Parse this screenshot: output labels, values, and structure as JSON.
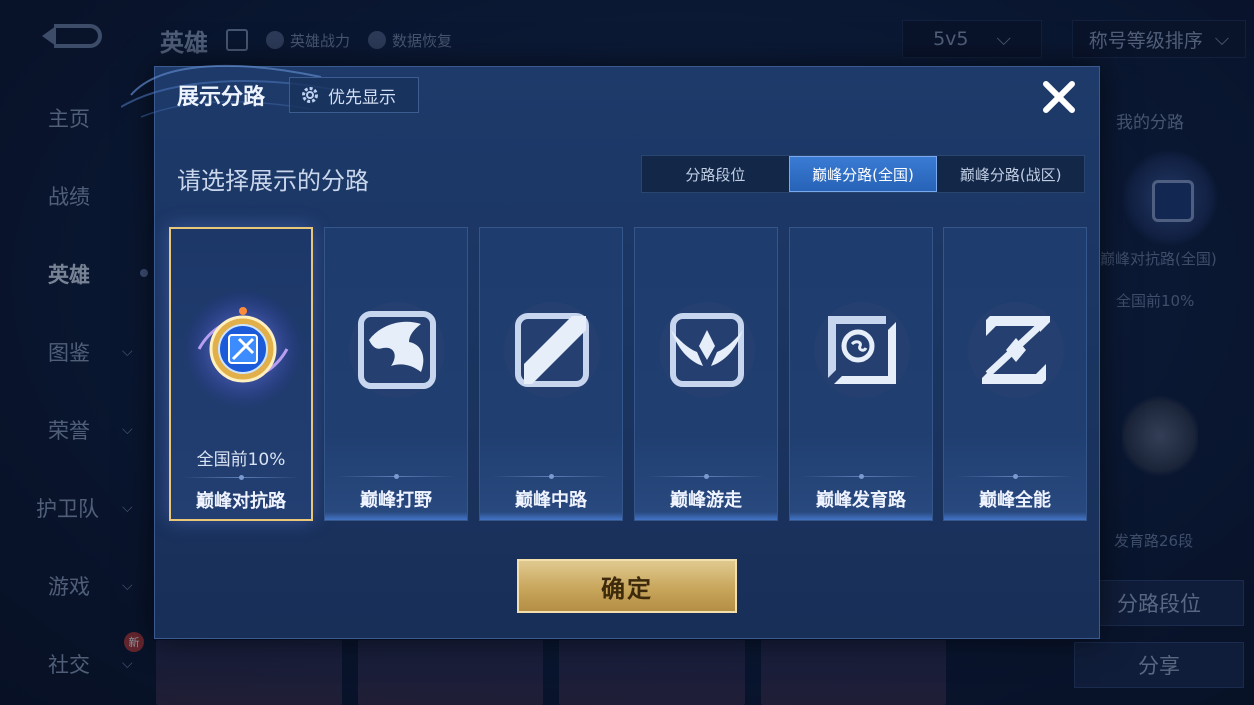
{
  "background": {
    "left_nav": [
      {
        "label": "主页",
        "chevron": false,
        "active": false
      },
      {
        "label": "战绩",
        "chevron": false,
        "active": false
      },
      {
        "label": "英雄",
        "chevron": false,
        "active": true
      },
      {
        "label": "图鉴",
        "chevron": true,
        "active": false
      },
      {
        "label": "荣誉",
        "chevron": true,
        "active": false
      },
      {
        "label": "护卫队",
        "chevron": true,
        "active": false
      },
      {
        "label": "游戏",
        "chevron": true,
        "active": false
      },
      {
        "label": "社交",
        "chevron": true,
        "active": false,
        "badge": "新"
      }
    ],
    "top_bar": {
      "title": "英雄",
      "link_power": "英雄战力",
      "link_recover": "数据恢复",
      "mode_select": "5v5",
      "sort_select": "称号等级排序"
    },
    "right_panel": {
      "title": "我的分路",
      "lane": "巅峰对抗路(全国)",
      "rank": "全国前10%",
      "lane2": "发育路26段",
      "btn_rank": "分路段位",
      "btn_share": "分享"
    }
  },
  "modal": {
    "title": "展示分路",
    "priority_button": "优先显示",
    "subtitle": "请选择展示的分路",
    "tabs": [
      {
        "label": "分路段位",
        "active": false
      },
      {
        "label": "巅峰分路(全国)",
        "active": true
      },
      {
        "label": "巅峰分路(战区)",
        "active": false
      }
    ],
    "lanes": [
      {
        "name": "巅峰对抗路",
        "rank": "全国前10%",
        "selected": true,
        "icon": "clash-lane-icon"
      },
      {
        "name": "巅峰打野",
        "rank": "",
        "selected": false,
        "icon": "jungle-dragon-icon"
      },
      {
        "name": "巅峰中路",
        "rank": "",
        "selected": false,
        "icon": "mid-lane-icon"
      },
      {
        "name": "巅峰游走",
        "rank": "",
        "selected": false,
        "icon": "roam-wings-icon"
      },
      {
        "name": "巅峰发育路",
        "rank": "",
        "selected": false,
        "icon": "farm-lane-icon"
      },
      {
        "name": "巅峰全能",
        "rank": "",
        "selected": false,
        "icon": "all-round-icon"
      }
    ],
    "confirm_button": "确定"
  },
  "colors": {
    "accent_blue": "#2f6fc6",
    "gold": "#d4b46e",
    "panel": "#1b3563"
  }
}
